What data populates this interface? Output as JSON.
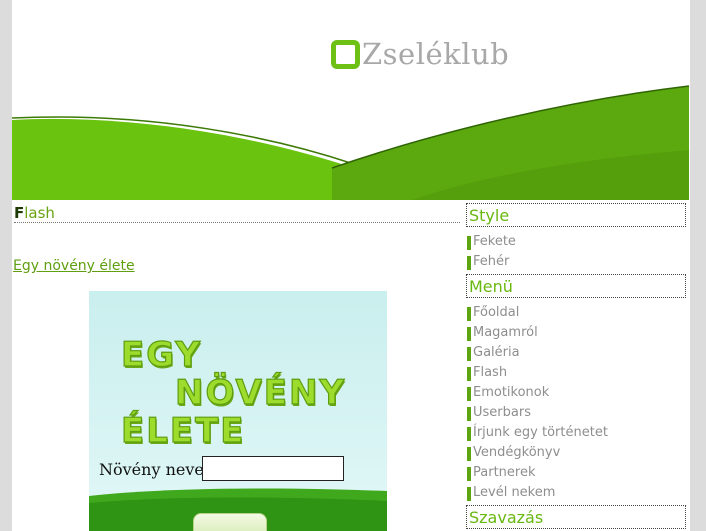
{
  "site": {
    "logo_text": "Zseléklub"
  },
  "main": {
    "section_title_first": "F",
    "section_title_rest": "lash",
    "game_link": "Egy növény élete"
  },
  "game": {
    "title_line1": "EGY",
    "title_line2": "NÖVÉNY",
    "title_line3": "ÉLETE",
    "name_label": "Növény neve:",
    "name_value": ""
  },
  "sidebar": {
    "style_heading": "Style",
    "style_items": [
      "Fekete",
      "Fehér"
    ],
    "menu_heading": "Menü",
    "menu_items": [
      "Főoldal",
      "Magamról",
      "Galéria",
      "Flash",
      "Emotikonok",
      "Userbars",
      "Írjunk egy történetet",
      "Vendégkönyv",
      "Partnerek",
      "Levél nekem"
    ],
    "poll_heading": "Szavazás"
  },
  "colors": {
    "accent_green": "#6cc114",
    "dark_green": "#5ea610",
    "text_gray": "#8e8e8e"
  }
}
